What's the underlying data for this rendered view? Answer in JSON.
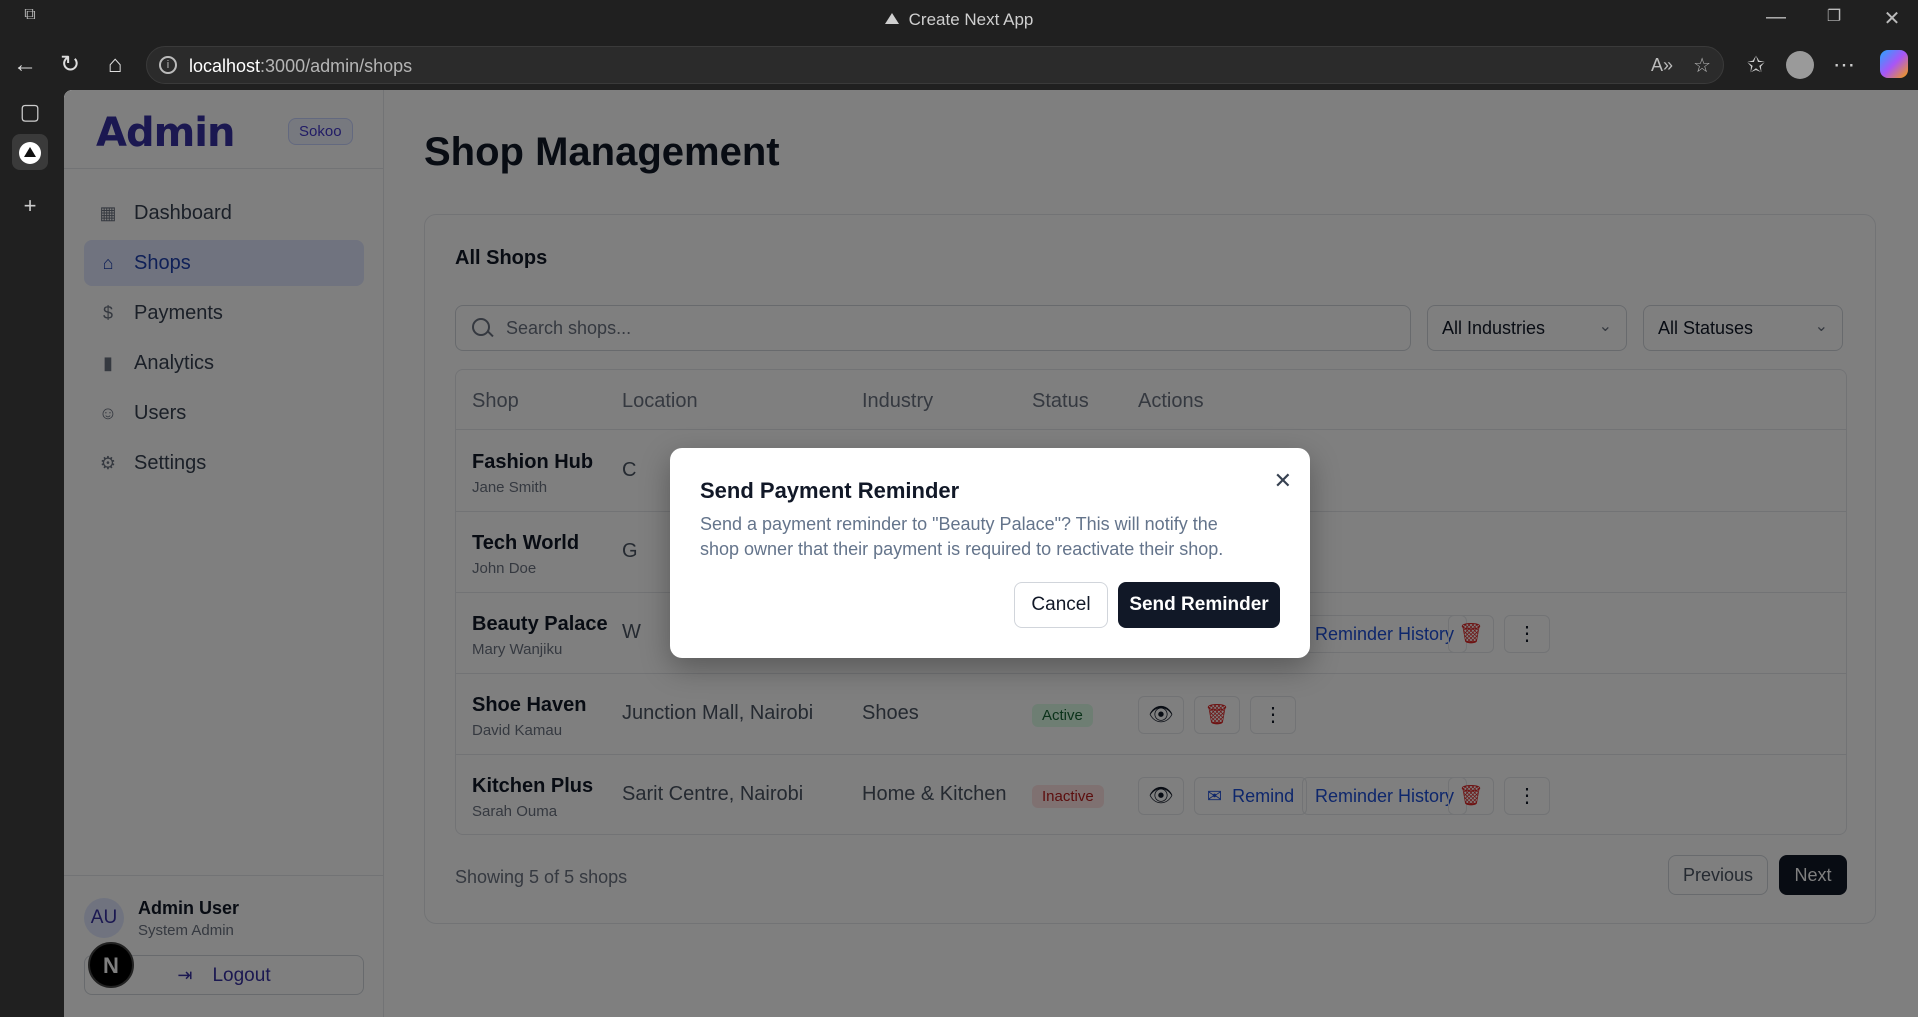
{
  "browser": {
    "window_title": "Create Next App",
    "url_host": "localhost",
    "url_path": ":3000/admin/shops"
  },
  "sidebar": {
    "logo": "Admin",
    "badge": "Sokoo",
    "items": [
      {
        "label": "Dashboard",
        "icon": "dashboard-icon"
      },
      {
        "label": "Shops",
        "icon": "store-icon",
        "active": true
      },
      {
        "label": "Payments",
        "icon": "dollar-icon"
      },
      {
        "label": "Analytics",
        "icon": "bar-chart-icon"
      },
      {
        "label": "Users",
        "icon": "users-icon"
      },
      {
        "label": "Settings",
        "icon": "gear-icon"
      }
    ],
    "user": {
      "initials": "AU",
      "name": "Admin User",
      "role": "System Admin"
    },
    "logout": "Logout",
    "n_badge": "N"
  },
  "main": {
    "title": "Shop Management",
    "card_title": "All Shops",
    "search_placeholder": "Search shops...",
    "filter_industry": "All Industries",
    "filter_status": "All Statuses",
    "columns": [
      "Shop",
      "Location",
      "Industry",
      "Status",
      "Actions"
    ],
    "rows": [
      {
        "shop": "Fashion Hub",
        "owner": "Jane Smith",
        "location": "C",
        "industry": "",
        "status": ""
      },
      {
        "shop": "Tech World",
        "owner": "John Doe",
        "location": "G",
        "industry": "",
        "status": ""
      },
      {
        "shop": "Beauty Palace",
        "owner": "Mary Wanjiku",
        "location": "W",
        "industry": "",
        "status": ""
      },
      {
        "shop": "Shoe Haven",
        "owner": "David Kamau",
        "location": "Junction Mall, Nairobi",
        "industry": "Shoes",
        "status": "Active"
      },
      {
        "shop": "Kitchen Plus",
        "owner": "Sarah Ouma",
        "location": "Sarit Centre, Nairobi",
        "industry": "Home & Kitchen",
        "status": "Inactive"
      }
    ],
    "remind_label": "Remind",
    "history_label": "Reminder History",
    "footer_text": "Showing 5 of 5 shops",
    "prev_label": "Previous",
    "next_label": "Next"
  },
  "modal": {
    "title": "Send Payment Reminder",
    "body": "Send a payment reminder to \"Beauty Palace\"? This will notify the shop owner that their payment is required to reactivate their shop.",
    "cancel": "Cancel",
    "confirm": "Send Reminder",
    "close_icon": "close-icon"
  }
}
